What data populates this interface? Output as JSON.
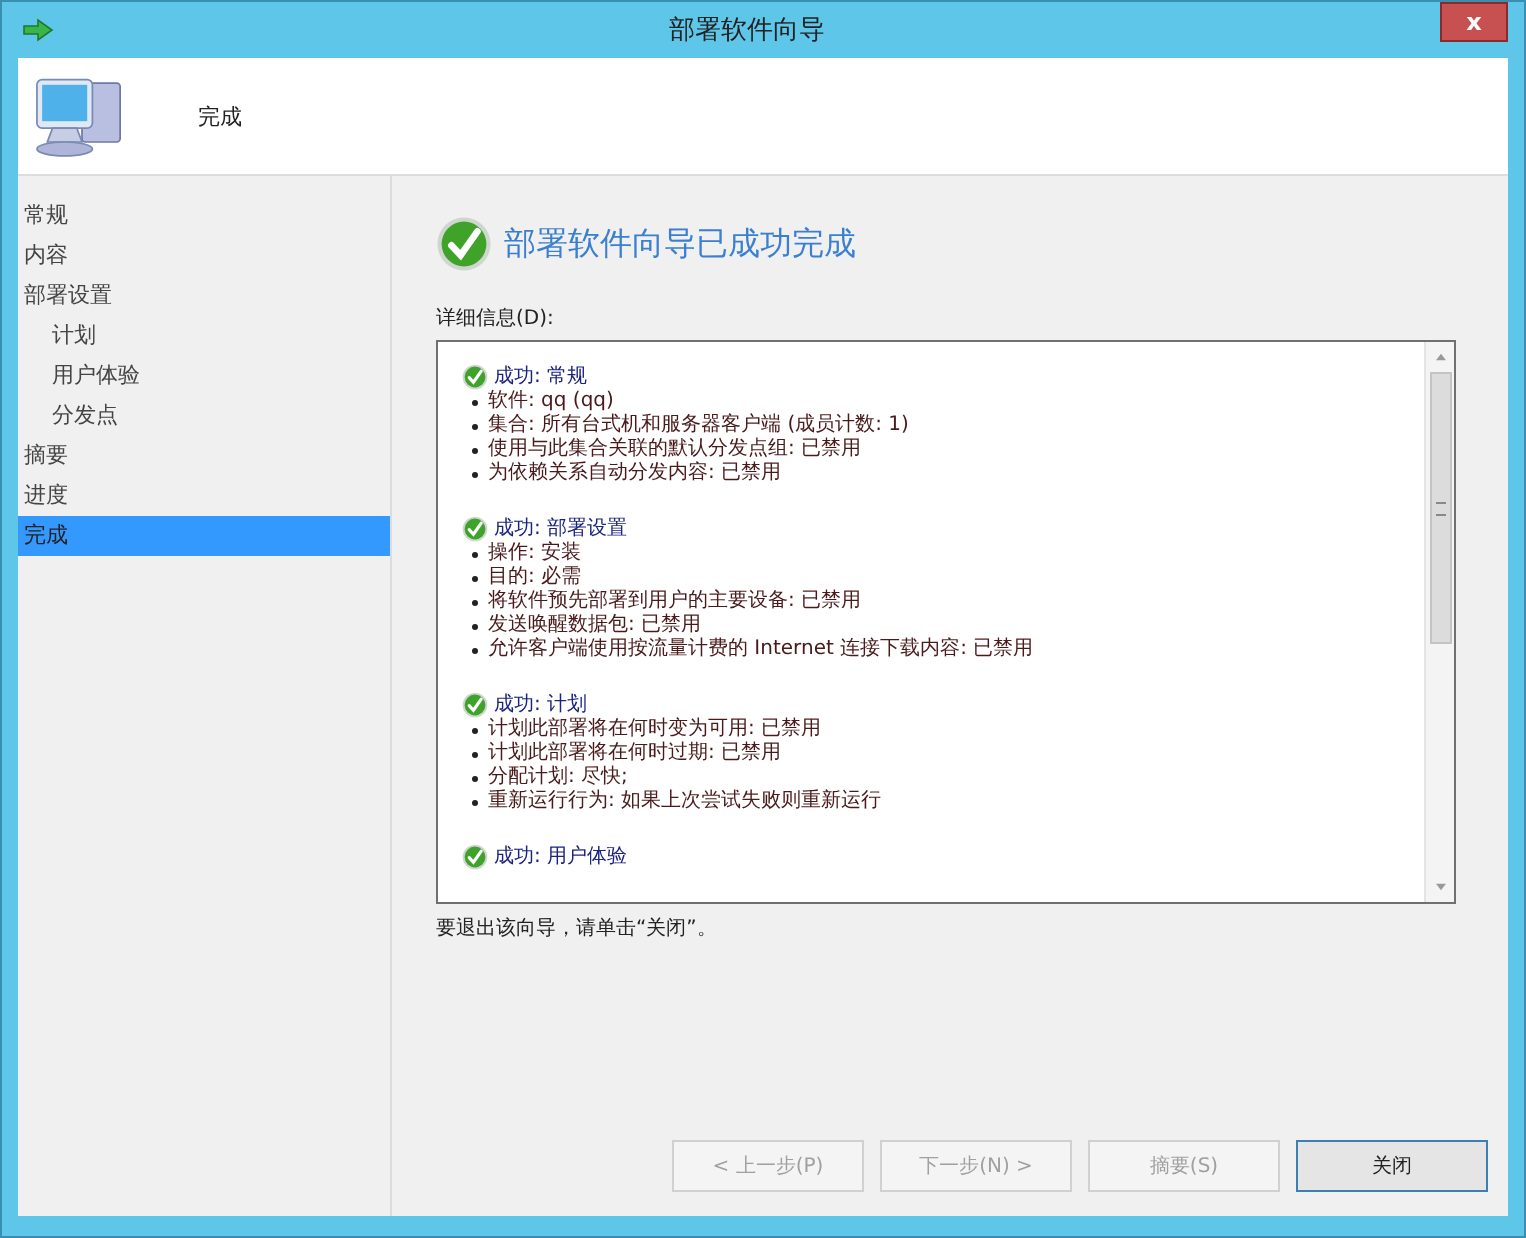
{
  "window": {
    "title": "部署软件向导",
    "close_label": "x"
  },
  "header": {
    "title": "完成"
  },
  "nav": [
    {
      "label": "常规",
      "selected": false
    },
    {
      "label": "内容",
      "selected": false
    },
    {
      "label": "部署设置",
      "selected": false,
      "children": [
        {
          "label": "计划",
          "selected": false
        },
        {
          "label": "用户体验",
          "selected": false
        },
        {
          "label": "分发点",
          "selected": false
        }
      ]
    },
    {
      "label": "摘要",
      "selected": false
    },
    {
      "label": "进度",
      "selected": false
    },
    {
      "label": "完成",
      "selected": true
    }
  ],
  "result": {
    "success": true,
    "heading": "部署软件向导已成功完成"
  },
  "details": {
    "label": "详细信息(D):",
    "sections": [
      {
        "success": true,
        "title": "成功: 常规",
        "items": [
          "软件: qq (qq)",
          "集合: 所有台式机和服务器客户端 (成员计数: 1)",
          "使用与此集合关联的默认分发点组: 已禁用",
          "为依赖关系自动分发内容: 已禁用"
        ]
      },
      {
        "success": true,
        "title": "成功: 部署设置",
        "items": [
          "操作: 安装",
          "目的: 必需",
          "将软件预先部署到用户的主要设备: 已禁用",
          "发送唤醒数据包: 已禁用",
          "允许客户端使用按流量计费的 Internet 连接下载内容: 已禁用"
        ]
      },
      {
        "success": true,
        "title": "成功: 计划",
        "items": [
          "计划此部署将在何时变为可用: 已禁用",
          "计划此部署将在何时过期: 已禁用",
          "分配计划: 尽快;",
          "重新运行行为: 如果上次尝试失败则重新运行"
        ]
      },
      {
        "success": true,
        "title": "成功: 用户体验"
      }
    ]
  },
  "exit_hint": "要退出该向导，请单击“关闭”。",
  "buttons": [
    {
      "label": "< 上一步(P)",
      "disabled": true,
      "default": false
    },
    {
      "label": "下一步(N) >",
      "disabled": true,
      "default": false
    },
    {
      "label": "摘要(S)",
      "disabled": true,
      "default": false
    },
    {
      "label": "关闭",
      "disabled": false,
      "default": true
    }
  ]
}
